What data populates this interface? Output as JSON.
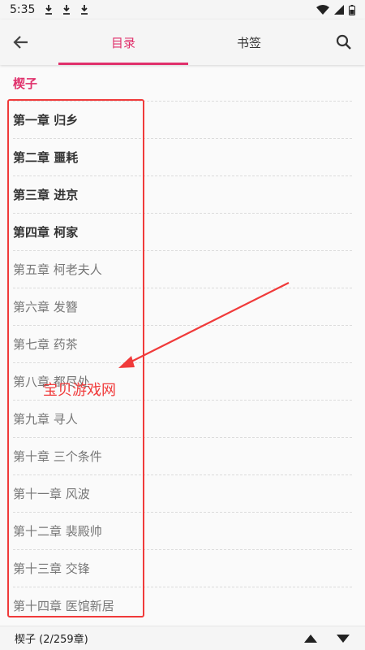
{
  "status_bar": {
    "time": "5:35"
  },
  "tabs": {
    "toc": "目录",
    "bookmarks": "书签"
  },
  "volume": "楔子",
  "chapters": [
    {
      "title": "第一章 归乡",
      "read": true
    },
    {
      "title": "第二章 噩耗",
      "read": true
    },
    {
      "title": "第三章 进京",
      "read": true
    },
    {
      "title": "第四章 柯家",
      "read": true
    },
    {
      "title": "第五章 柯老夫人",
      "read": false
    },
    {
      "title": "第六章 发簪",
      "read": false
    },
    {
      "title": "第七章 药茶",
      "read": false
    },
    {
      "title": "第八章 都尽处",
      "read": false
    },
    {
      "title": "第九章 寻人",
      "read": false
    },
    {
      "title": "第十章 三个条件",
      "read": false
    },
    {
      "title": "第十一章 风波",
      "read": false
    },
    {
      "title": "第十二章 裴殿帅",
      "read": false
    },
    {
      "title": "第十三章 交锋",
      "read": false
    },
    {
      "title": "第十四章 医馆新居",
      "read": false
    }
  ],
  "watermark": "宝贝游戏网",
  "bottom_bar": {
    "position_text": "楔子 (2/259章)"
  },
  "colors": {
    "accent": "#e0306b",
    "annotation": "#f03a3a"
  }
}
